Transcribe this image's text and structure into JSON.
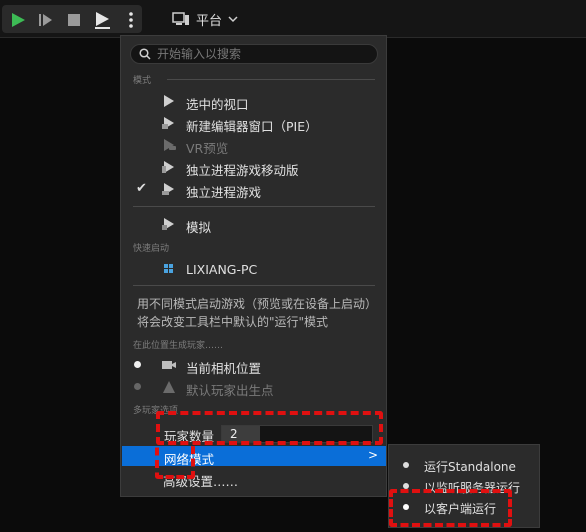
{
  "toolbar": {
    "buttons": [
      "play-icon",
      "step-icon",
      "stop-icon",
      "eject-icon",
      "more-options-icon"
    ],
    "platform_label": "平台"
  },
  "menu": {
    "search_placeholder": "开始输入以搜索",
    "section_mode": "模式",
    "items_mode": [
      {
        "label": "选中的视口",
        "icon": "play-icon"
      },
      {
        "label": "新建编辑器窗口（PIE）",
        "icon": "window-play-icon"
      },
      {
        "label": "VR预览",
        "icon": "vr-icon"
      },
      {
        "label": "独立进程游戏移动版",
        "icon": "mobile-play-icon"
      },
      {
        "label": "独立进程游戏",
        "icon": "standalone-play-icon"
      }
    ],
    "simulate_label": "模拟",
    "section_quick_launch": "快速启动",
    "quick_launch_device": "LIXIANG-PC",
    "description": "用不同模式启动游戏（预览或在设备上启动）将会改变工具栏中默认的\"运行\"模式",
    "section_spawn": "在此位置生成玩家……",
    "spawn_options": [
      "当前相机位置",
      "默认玩家出生点"
    ],
    "section_multiplayer": "多玩家选项",
    "player_count_label": "玩家数量",
    "player_count_value": "2",
    "player_count_fraction": 0.25,
    "net_mode_label": "网络模式",
    "advanced_label": "高级设置……"
  },
  "submenu": {
    "items": [
      "运行Standalone",
      "以监听服务器运行",
      "以客户端运行"
    ]
  },
  "colors": {
    "highlight": "#0a6ed8",
    "play_green": "#37b24d",
    "annotation_red": "#e01010"
  }
}
